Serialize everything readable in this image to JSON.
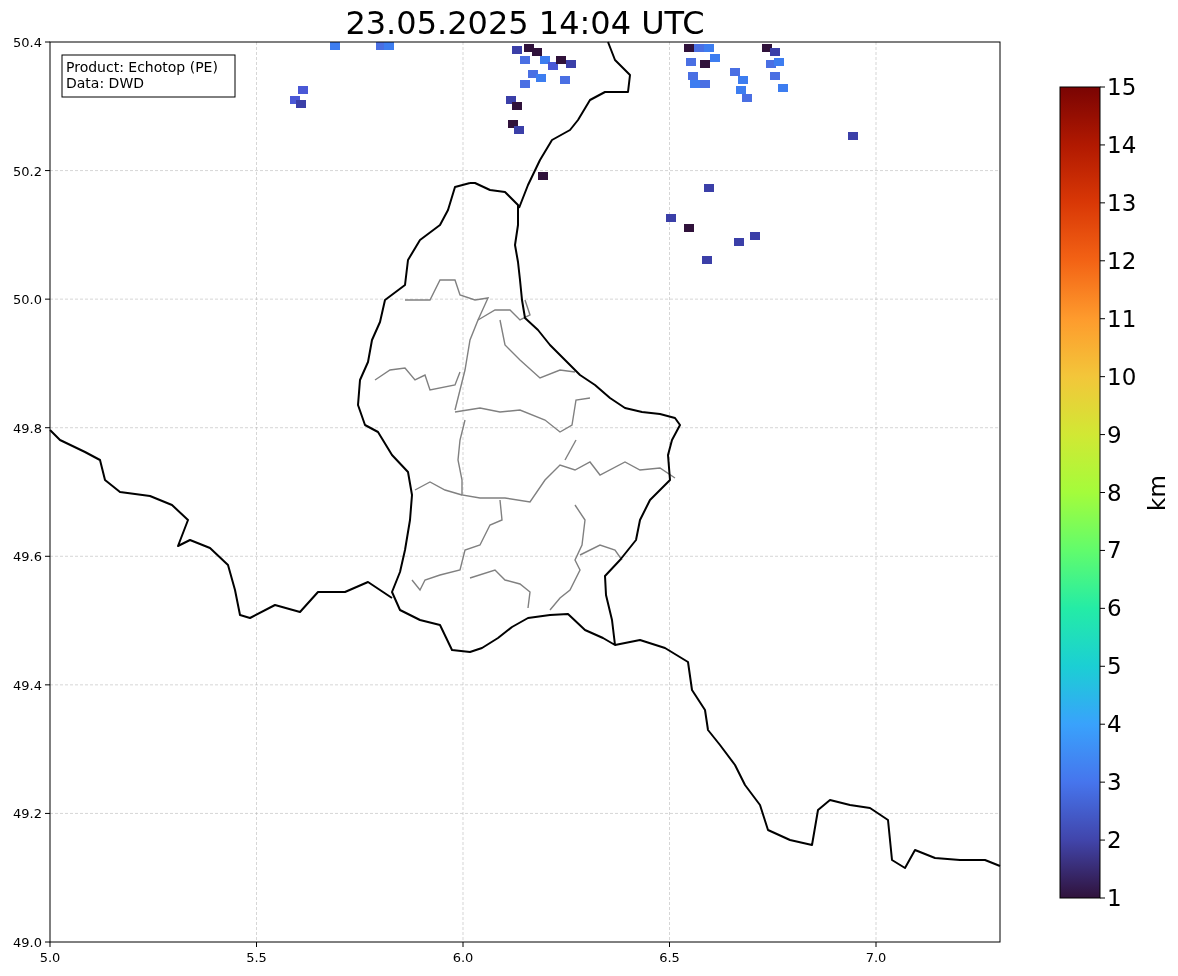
{
  "title": "23.05.2025 14:04 UTC",
  "map": {
    "info_box": [
      "Product: Echotop (PE)",
      "Data: DWD"
    ],
    "xticks": [
      "5.0",
      "5.5",
      "6.0",
      "6.5",
      "7.0"
    ],
    "yticks": [
      "50.4",
      "50.2",
      "50.0",
      "49.8",
      "49.6",
      "49.4",
      "49.2",
      "49.0"
    ]
  },
  "colorbar": {
    "label": "km",
    "ticks": [
      "15",
      "14",
      "13",
      "12",
      "11",
      "10",
      "9",
      "8",
      "7",
      "6",
      "5",
      "4",
      "3",
      "2",
      "1"
    ]
  }
}
